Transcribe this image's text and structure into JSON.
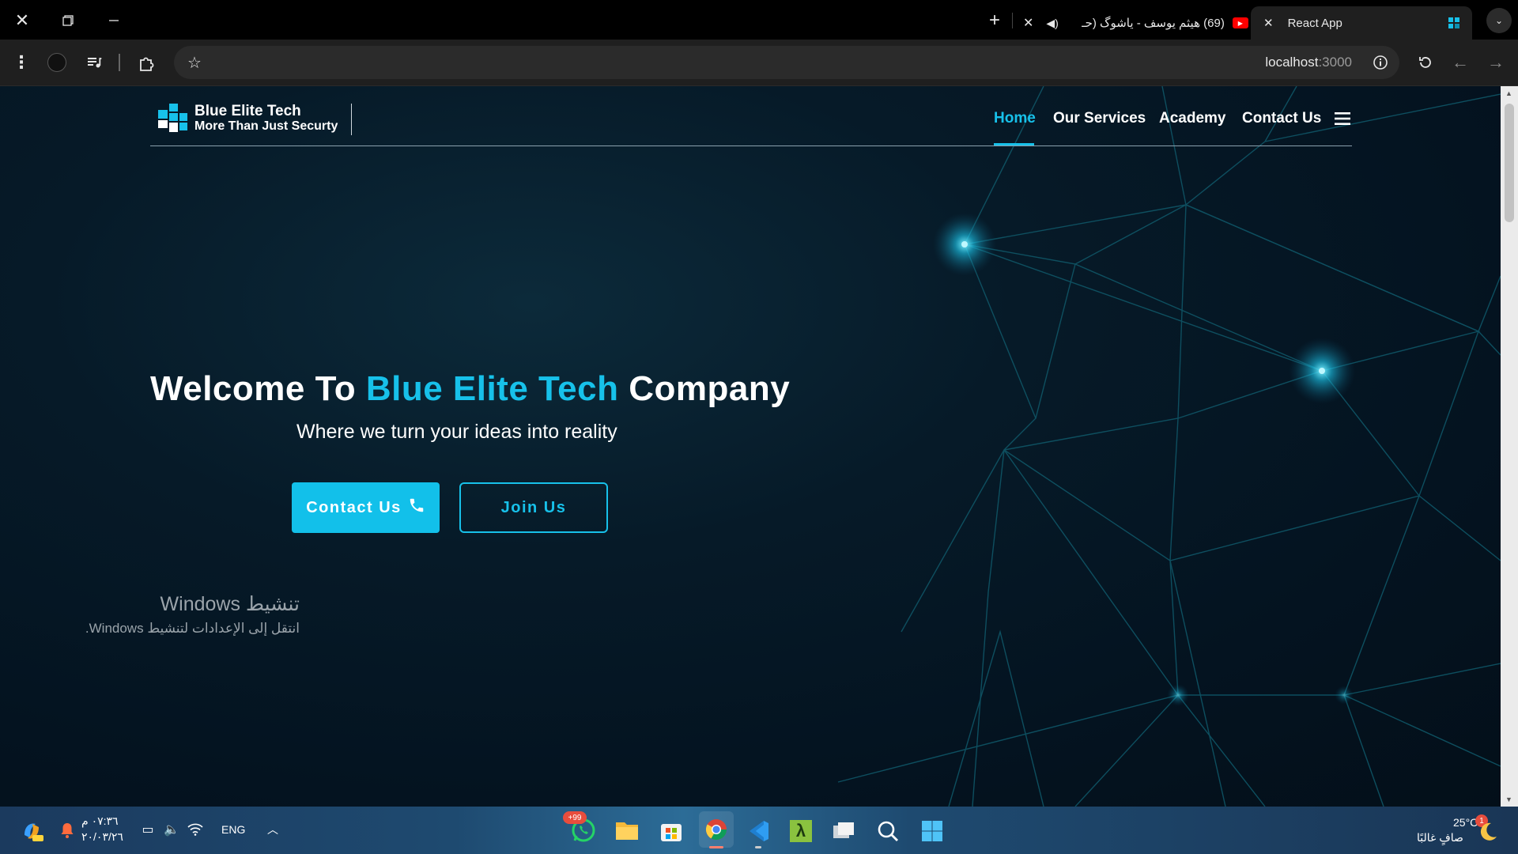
{
  "browser": {
    "tabs": [
      {
        "title": "React App",
        "active": true
      },
      {
        "title": "(69) هيثم يوسف - ياشوگ (حـ",
        "active": false
      }
    ],
    "url": {
      "host": "localhost",
      "port": ":3000"
    }
  },
  "site": {
    "brand": {
      "name": "Blue Elite Tech",
      "tagline": "More Than Just Securty"
    },
    "nav": [
      {
        "label": "Home",
        "active": true
      },
      {
        "label": "Our Services"
      },
      {
        "label": "Academy"
      },
      {
        "label": "Contact Us"
      }
    ],
    "hero": {
      "title_prefix": "Welcome To ",
      "title_accent": "Blue Elite Tech",
      "title_suffix": " Company",
      "subtitle": "Where we turn your ideas into reality",
      "primary_button": "Contact Us",
      "secondary_button": "Join Us"
    },
    "colors": {
      "accent": "#17c1ea",
      "background": "#041320"
    }
  },
  "windows": {
    "activation": {
      "title": "تنشيط Windows",
      "subtitle": "انتقل إلى الإعدادات لتنشيط Windows."
    },
    "taskbar": {
      "weather": {
        "temp": "25°C",
        "condition": "صافٍ غالبًا",
        "badge": "1"
      },
      "whatsapp_badge": "+99",
      "language": "ENG",
      "time": "٠٧:٣٦ م",
      "date": "٢٠/٠٣/٢٦"
    }
  }
}
